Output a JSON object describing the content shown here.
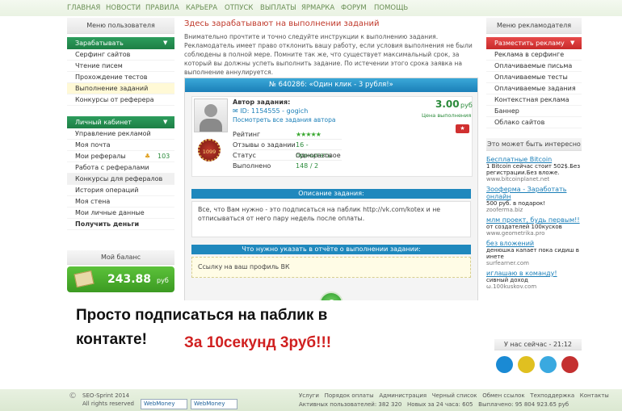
{
  "topnav": [
    "ГЛАВНАЯ",
    "НОВОСТИ",
    "ПРАВИЛА",
    "КАРЬЕРА",
    "ОТПУСК",
    "ВЫПЛАТЫ",
    "ЯРМАРКА",
    "ФОРУМ",
    "ПОМОЩЬ"
  ],
  "user_menu": {
    "title": "Меню пользователя",
    "earn_label": "Зарабатывать",
    "earn_items": [
      "Серфинг сайтов",
      "Чтение писем",
      "Прохождение тестов",
      "Выполнение заданий",
      "Конкурсы от реферера"
    ],
    "cabinet_label": "Личный кабинет",
    "cabinet_items": [
      "Управление рекламой",
      "Моя почта",
      "Мои рефералы",
      "Работа с рефералами",
      "Конкурсы для рефералов",
      "История операций",
      "Моя стена",
      "Мои личные данные",
      "Получить деньги"
    ],
    "referrals_count": "103"
  },
  "balance": {
    "title": "Мой баланс",
    "amount": "243.88",
    "currency": "руб"
  },
  "main": {
    "heading": "Здесь зарабатывают на выполнении заданий",
    "intro": "Внимательно прочтите и точно следуйте инструкции к выполнению задания. Рекламодатель имеет право отклонить вашу работу, если условия выполнения не были соблюдены в полной мере. Помните так же, что существует максимальный срок, за который вы должны успеть выполнить задание. По истечении этого срока заявка на выполнение аннулируется.",
    "task_title": "№ 640286: «Один клик - 3 рубля!»",
    "author_label": "Автор задания:",
    "author_id": "ID: 1154555 - gogich",
    "author_link": "Посмотреть все задания автора",
    "price": "3.00",
    "price_unit": "руб",
    "price_caption": "Цена выполнения",
    "badge": "1099",
    "rows": [
      {
        "label": "Рейтинг",
        "value": "★★★★★"
      },
      {
        "label": "Отзывы о задании",
        "value": "16 - прочитать"
      },
      {
        "label": "Статус",
        "value": "Одноразовое"
      },
      {
        "label": "Выполнено",
        "value": "148 / 2"
      }
    ],
    "desc_title": "Описание задания:",
    "desc_text": "Все, что Вам нужно - это подписаться на паблик http://vk.com/kotex и не отписываться от него пару недель после оплаты.",
    "report_title": "Что нужно указать в отчёте о выполнении задании:",
    "report_text": "Ссылку на ваш профиль ВК"
  },
  "overlay": {
    "line1": "Просто подписаться на паблик в",
    "line2": "контакте!",
    "promo": "За 10секунд 3руб!!!"
  },
  "ad_menu": {
    "title": "Меню рекламодателя",
    "place_label": "Разместить рекламу",
    "items": [
      "Реклама в серфинге",
      "Оплачиваемые письма",
      "Оплачиваемые тесты",
      "Оплачиваемые задания",
      "Контекстная реклама",
      "Баннер",
      "Облако сайтов"
    ]
  },
  "interesting": {
    "title": "Это может быть интересно",
    "ads": [
      {
        "title": "Бесплатные Bitcoin",
        "desc": "1 Bitcoin сейчас стоит 502$.Без регистрации.Без вложе.",
        "url": "www.bitcoinplanet.net"
      },
      {
        "title": "Зooферма - Заработать онлайн",
        "desc": "500 руб. в подарок!",
        "url": "zooferma.biz"
      },
      {
        "title": "млм проект, будь первым!!",
        "desc": "от создателей 100кусков",
        "url": "www.geometrika.pro"
      },
      {
        "title": "без вложений",
        "desc": "денюшка капает пока сидиш в инете",
        "url": "surfearner.com"
      },
      {
        "title": "иглашаю в команду!",
        "desc": "сивный доход",
        "url": "ѡ.100kuskov.com"
      }
    ]
  },
  "now": {
    "label": "У нас сейчас - 21:12"
  },
  "social_colors": [
    "#1a8ad4",
    "#e0c020",
    "#3aa9e0",
    "#c43030"
  ],
  "footer": {
    "copyright": "SEO-Sprint 2014",
    "rights": "All rights reserved",
    "webmoney": "WebMoney",
    "links_top": "Услуги   Порядок оплаты   Администрация   Черный список   Обмен ссылок   Техподдержка   Контакты",
    "links_bottom": "Активных пользователей: 382 320   Новых за 24 часа: 605   Выплачено: 95 804 923.65 руб"
  }
}
